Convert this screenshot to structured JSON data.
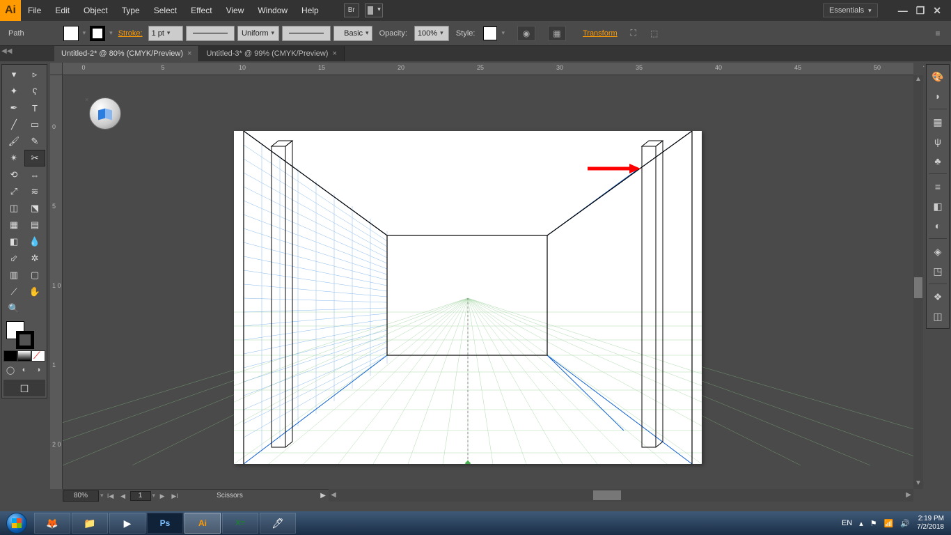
{
  "menu": {
    "items": [
      "File",
      "Edit",
      "Object",
      "Type",
      "Select",
      "Effect",
      "View",
      "Window",
      "Help"
    ],
    "br": "Br",
    "workspace": "Essentials"
  },
  "controlbar": {
    "selection": "Path",
    "stroke_label": "Stroke:",
    "stroke_weight": "1 pt",
    "profile": "Uniform",
    "brush": "Basic",
    "opacity_label": "Opacity:",
    "opacity_value": "100%",
    "style_label": "Style:",
    "transform": "Transform"
  },
  "tabs": [
    {
      "label": "Untitled-2* @ 80% (CMYK/Preview)",
      "active": true
    },
    {
      "label": "Untitled-3* @ 99% (CMYK/Preview)",
      "active": false
    }
  ],
  "ruler_h": [
    0,
    5,
    10,
    15,
    20,
    25,
    30,
    35,
    40,
    45,
    50
  ],
  "ruler_v": [
    "0",
    "5",
    "1 0",
    "1",
    "2 0"
  ],
  "status": {
    "zoom": "80%",
    "page": "1",
    "tool": "Scissors"
  },
  "tray": {
    "lang": "EN",
    "time": "2:19 PM",
    "date": "7/2/2018"
  }
}
